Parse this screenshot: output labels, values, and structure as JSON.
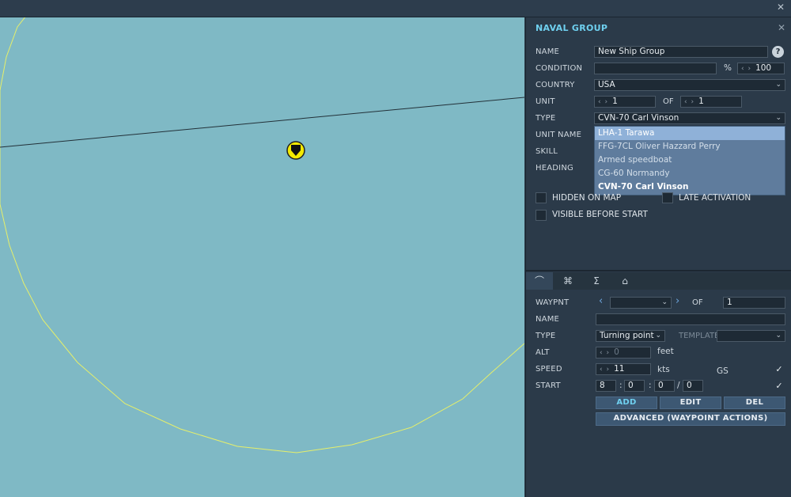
{
  "window": {
    "close_label": "✕"
  },
  "panel": {
    "title": "NAVAL GROUP",
    "close_label": "✕",
    "name": {
      "label": "NAME",
      "value": "New Ship Group",
      "help": "?"
    },
    "condition": {
      "label": "CONDITION",
      "value": "",
      "percent_sign": "%",
      "percent_value": "100"
    },
    "country": {
      "label": "COUNTRY",
      "value": "USA"
    },
    "unit": {
      "label": "UNIT",
      "value": "1",
      "of_label": "OF",
      "of_value": "1"
    },
    "type": {
      "label": "TYPE",
      "value": "CVN-70 Carl Vinson"
    },
    "unit_name": {
      "label": "UNIT NAME"
    },
    "skill": {
      "label": "SKILL"
    },
    "heading": {
      "label": "HEADING"
    },
    "type_dropdown": [
      {
        "label": "LHA-1 Tarawa"
      },
      {
        "label": "FFG-7CL Oliver Hazzard Perry"
      },
      {
        "label": "Armed speedboat"
      },
      {
        "label": "CG-60 Normandy"
      },
      {
        "label": "CVN-70 Carl Vinson"
      }
    ],
    "hidden_on_map": "HIDDEN ON MAP",
    "late_activation": "LATE ACTIVATION",
    "visible_before_start": "VISIBLE BEFORE START"
  },
  "tabs": [
    {
      "icon": "route-icon",
      "glyph": "⌒"
    },
    {
      "icon": "command-icon",
      "glyph": "⌘"
    },
    {
      "icon": "sigma-icon",
      "glyph": "Σ"
    },
    {
      "icon": "cargo-icon",
      "glyph": "⌂"
    }
  ],
  "waypoint": {
    "waypnt_label": "WAYPNT",
    "waypnt_value": "",
    "of_label": "OF",
    "of_value": "1",
    "name_label": "NAME",
    "name_value": "",
    "type_label": "TYPE",
    "type_value": "Turning point",
    "template_label": "TEMPLATE",
    "template_value": "",
    "alt_label": "ALT",
    "alt_value": "0",
    "alt_unit": "feet",
    "speed_label": "SPEED",
    "speed_value": "11",
    "speed_unit": "kts",
    "gs_label": "GS",
    "start_label": "START",
    "start": {
      "h": "8",
      "m": "0",
      "s": "0",
      "f": "0"
    },
    "add_label": "ADD",
    "edit_label": "EDIT",
    "del_label": "DEL",
    "advanced_label": "ADVANCED (WAYPOINT ACTIONS)"
  },
  "colors": {
    "map_water": "#7fb9c5",
    "panel_bg": "#2b3a49",
    "accent": "#6fd0ef",
    "unit_marker": "#f4ea00"
  }
}
